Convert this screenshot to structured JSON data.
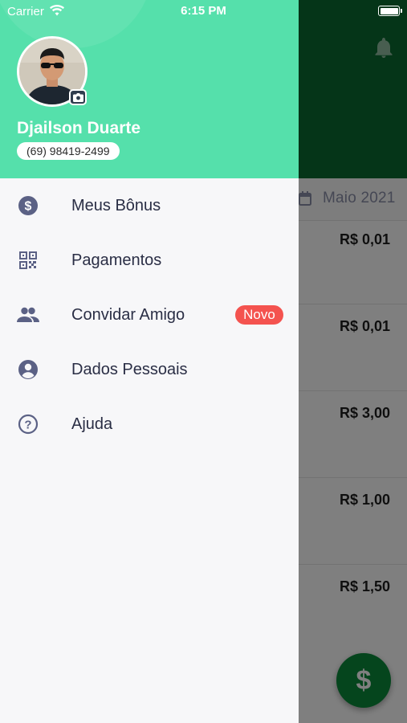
{
  "status_bar": {
    "carrier": "Carrier",
    "time": "6:15 PM"
  },
  "profile": {
    "name": "Djailson Duarte",
    "phone": "(69) 98419-2499"
  },
  "menu": [
    {
      "label": "Meus Bônus",
      "icon": "dollar-circle-icon"
    },
    {
      "label": "Pagamentos",
      "icon": "qr-code-icon"
    },
    {
      "label": "Convidar Amigo",
      "icon": "people-icon",
      "badge": "Novo"
    },
    {
      "label": "Dados Pessoais",
      "icon": "account-circle-icon"
    },
    {
      "label": "Ajuda",
      "icon": "help-circle-icon"
    }
  ],
  "background": {
    "month": "Maio 2021",
    "amounts": [
      "R$ 0,01",
      "R$ 0,01",
      "R$ 3,00",
      "R$ 1,00",
      "R$ 1,50"
    ],
    "fab_symbol": "$"
  },
  "colors": {
    "drawer_header": "#55e0ab",
    "app_header": "#0b6b30",
    "badge": "#f4534f",
    "icon": "#5b6185",
    "fab": "#0b8a3a"
  }
}
